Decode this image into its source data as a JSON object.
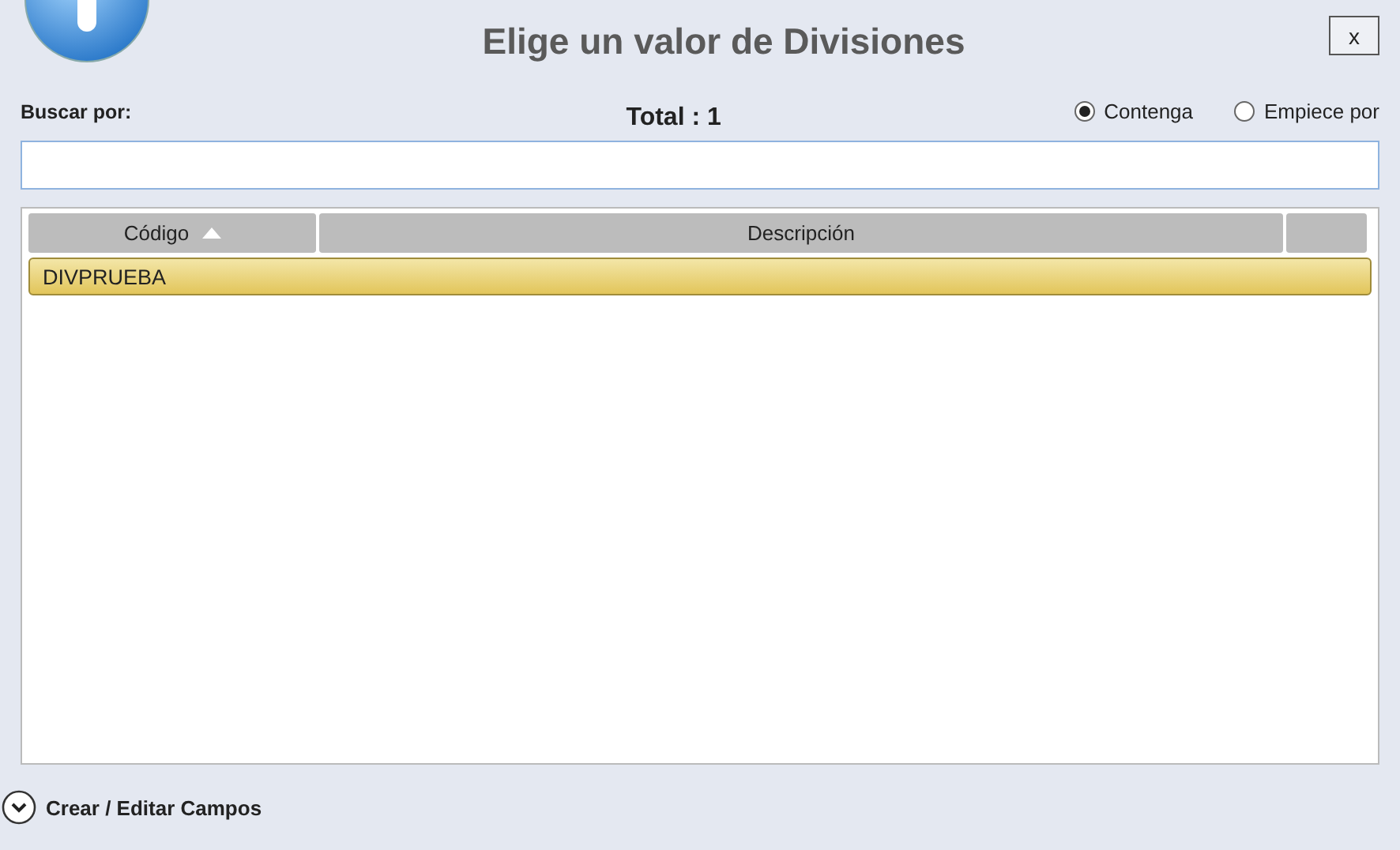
{
  "window": {
    "title": "Elige un valor de Divisiones",
    "close": "x"
  },
  "search": {
    "label": "Buscar por:",
    "total": "Total : 1",
    "modes": [
      {
        "label": "Contenga",
        "selected": true
      },
      {
        "label": "Empiece por",
        "selected": false
      }
    ]
  },
  "table": {
    "columns": [
      {
        "label": "Código",
        "sorted": true
      },
      {
        "label": "Descripción",
        "sorted": false
      }
    ],
    "rows": [
      {
        "code": "DIVPRUEBA",
        "selected": true
      }
    ]
  },
  "footer": {
    "label": "Crear / Editar Campos",
    "expanded": false
  }
}
